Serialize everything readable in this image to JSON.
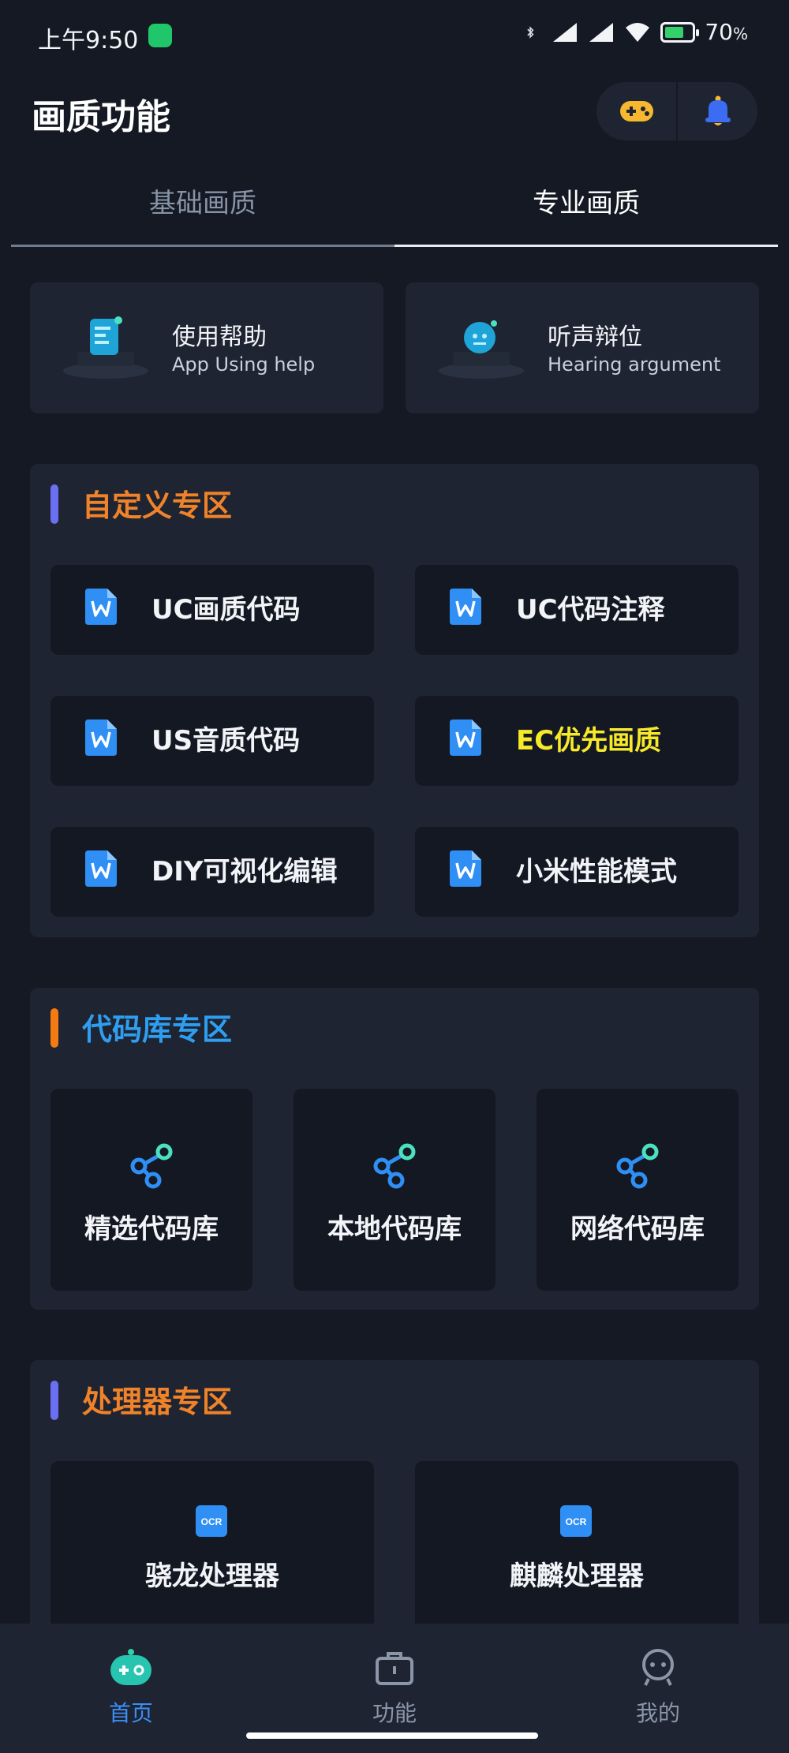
{
  "status_bar": {
    "time": "上午9:50",
    "battery": "70",
    "battery_unit": "%",
    "battery_level": 0.7
  },
  "header": {
    "title": "画质功能",
    "game_icon": "gamepad-icon",
    "bell_icon": "bell-icon"
  },
  "tabs": [
    {
      "label": "基础画质",
      "active": false
    },
    {
      "label": "专业画质",
      "active": true
    }
  ],
  "help_cards": [
    {
      "title": "使用帮助",
      "subtitle": "App Using help"
    },
    {
      "title": "听声辩位",
      "subtitle": "Hearing argument"
    }
  ],
  "custom_section": {
    "title": "自定义专区",
    "bar_color": "#6b6ff2",
    "title_color": "#f0832a",
    "items": [
      {
        "label": "UC画质代码"
      },
      {
        "label": "UC代码注释"
      },
      {
        "label": "US音质代码"
      },
      {
        "label": "EC优先画质",
        "color": "#f6ea29"
      },
      {
        "label": "DIY可视化编辑"
      },
      {
        "label": "小米性能模式"
      }
    ]
  },
  "library_section": {
    "title": "代码库专区",
    "bar_color": "#f47a12",
    "title_color": "#2f9ef0",
    "items": [
      {
        "label": "精选代码库"
      },
      {
        "label": "本地代码库"
      },
      {
        "label": "网络代码库"
      }
    ]
  },
  "processor_section": {
    "title": "处理器专区",
    "bar_color": "#6b6ff2",
    "title_color": "#f0832a",
    "items": [
      {
        "label": "骁龙处理器",
        "icon_text": "OCR"
      },
      {
        "label": "麒麟处理器",
        "icon_text": "OCR"
      }
    ]
  },
  "bottom_nav": [
    {
      "label": "首页",
      "icon": "gamepad-bot-icon",
      "active": true
    },
    {
      "label": "功能",
      "icon": "briefcase-icon",
      "active": false
    },
    {
      "label": "我的",
      "icon": "robot-face-icon",
      "active": false
    }
  ],
  "colors": {
    "background": "#151923",
    "card": "#1e2431",
    "cell": "#141823",
    "accent_blue": "#3a8ff5"
  }
}
